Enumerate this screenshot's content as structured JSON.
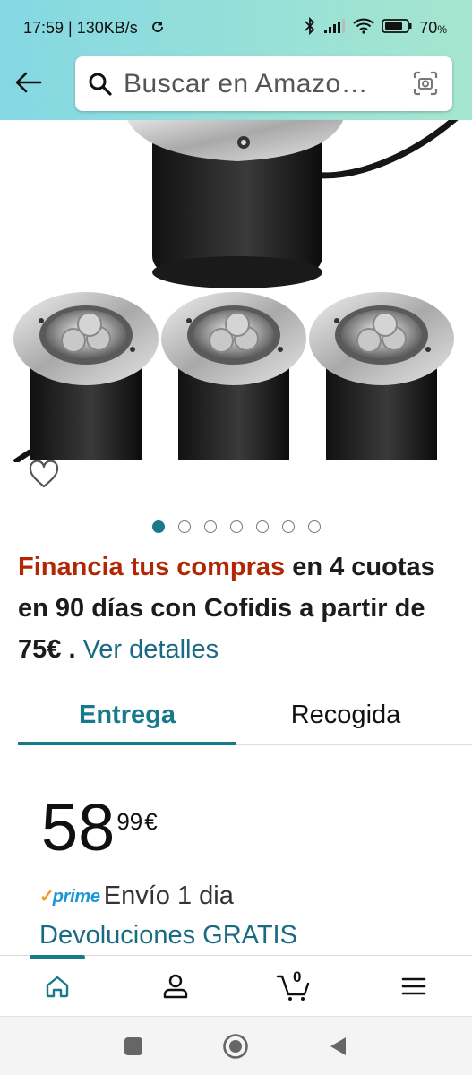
{
  "status_bar": {
    "time": "17:59 | 130KB/s",
    "battery": "70"
  },
  "search": {
    "placeholder": "Buscar en Amazo…"
  },
  "carousel": {
    "dot_count": 7,
    "active_index": 0
  },
  "finance": {
    "highlight": "Financia tus compras",
    "text": " en 4 cuotas en 90 días con Cofidis a partir de 75€ . ",
    "link": "Ver detalles"
  },
  "tabs": [
    {
      "label": "Entrega",
      "selected": true
    },
    {
      "label": "Recogida",
      "selected": false
    }
  ],
  "price": {
    "whole": "58",
    "fraction": "99",
    "currency": "€"
  },
  "shipping": {
    "prime_label": "prime",
    "text": "Envío 1 dia"
  },
  "returns": {
    "text": "Devoluciones GRATIS"
  },
  "colors": {
    "accent": "#167a8b",
    "finance_red": "#b12704",
    "link": "#1a6b82",
    "prime_blue": "#1a98d5"
  },
  "bottom_nav": {
    "items": [
      "home-icon",
      "account-icon",
      "cart-icon",
      "menu-icon"
    ],
    "cart_count": "0"
  }
}
